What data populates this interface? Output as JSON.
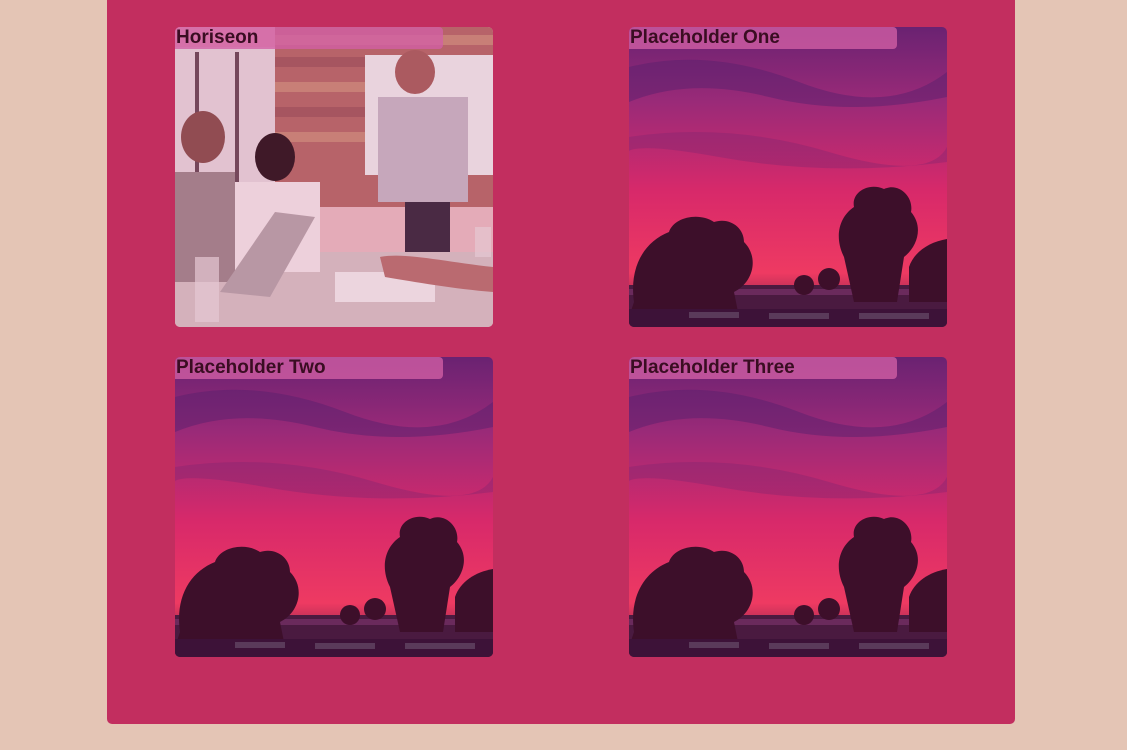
{
  "colors": {
    "page_background": "#e4c5b5",
    "panel_background": "#c22e5f",
    "title_bar": "#d25fa5",
    "title_text": "#3a0d22"
  },
  "cards": [
    {
      "title": "Horiseon",
      "image": "team-meeting-photo"
    },
    {
      "title": "Placeholder One",
      "image": "sunset-trees-photo"
    },
    {
      "title": "Placeholder Two",
      "image": "sunset-trees-photo"
    },
    {
      "title": "Placeholder Three",
      "image": "sunset-trees-photo"
    }
  ]
}
